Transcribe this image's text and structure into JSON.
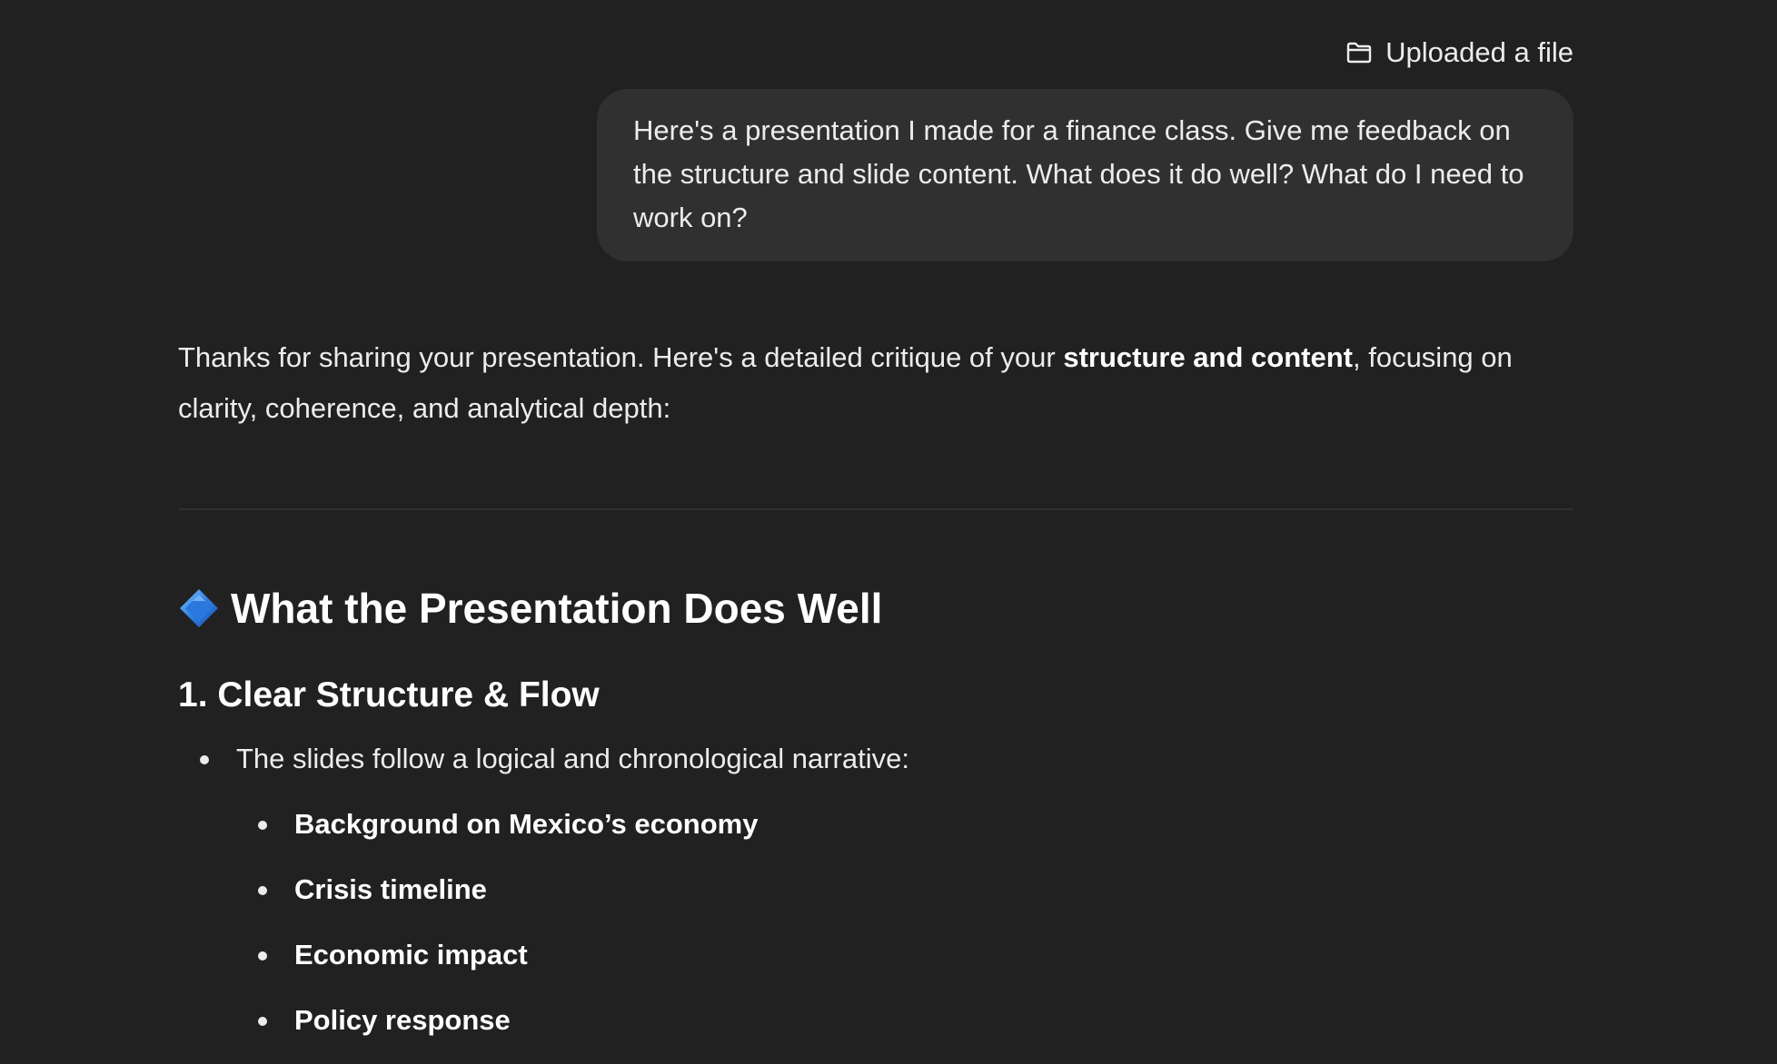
{
  "upload": {
    "icon": "folder-icon",
    "label": "Uploaded a file"
  },
  "user_message": {
    "text": "Here's a presentation I made for a finance class. Give me feedback on the structure and slide content. What does it do well? What do I need to work on?"
  },
  "assistant": {
    "intro_before": "Thanks for sharing your presentation. Here's a detailed critique of your ",
    "intro_bold": "structure and content",
    "intro_after": ", focusing on clarity, coherence, and analytical depth:",
    "section_icon": "blue-diamond-icon",
    "section_title": "What the Presentation Does Well",
    "subsection_title": "1. Clear Structure & Flow",
    "bullet": "The slides follow a logical and chronological narrative:",
    "sub_bullets": [
      "Background on Mexico’s economy",
      "Crisis timeline",
      "Economic impact",
      "Policy response"
    ]
  },
  "colors": {
    "background": "#212121",
    "bubble": "#303030",
    "text": "#ececec",
    "divider": "#2f2f2f",
    "diamond": "#2f7fe0"
  }
}
